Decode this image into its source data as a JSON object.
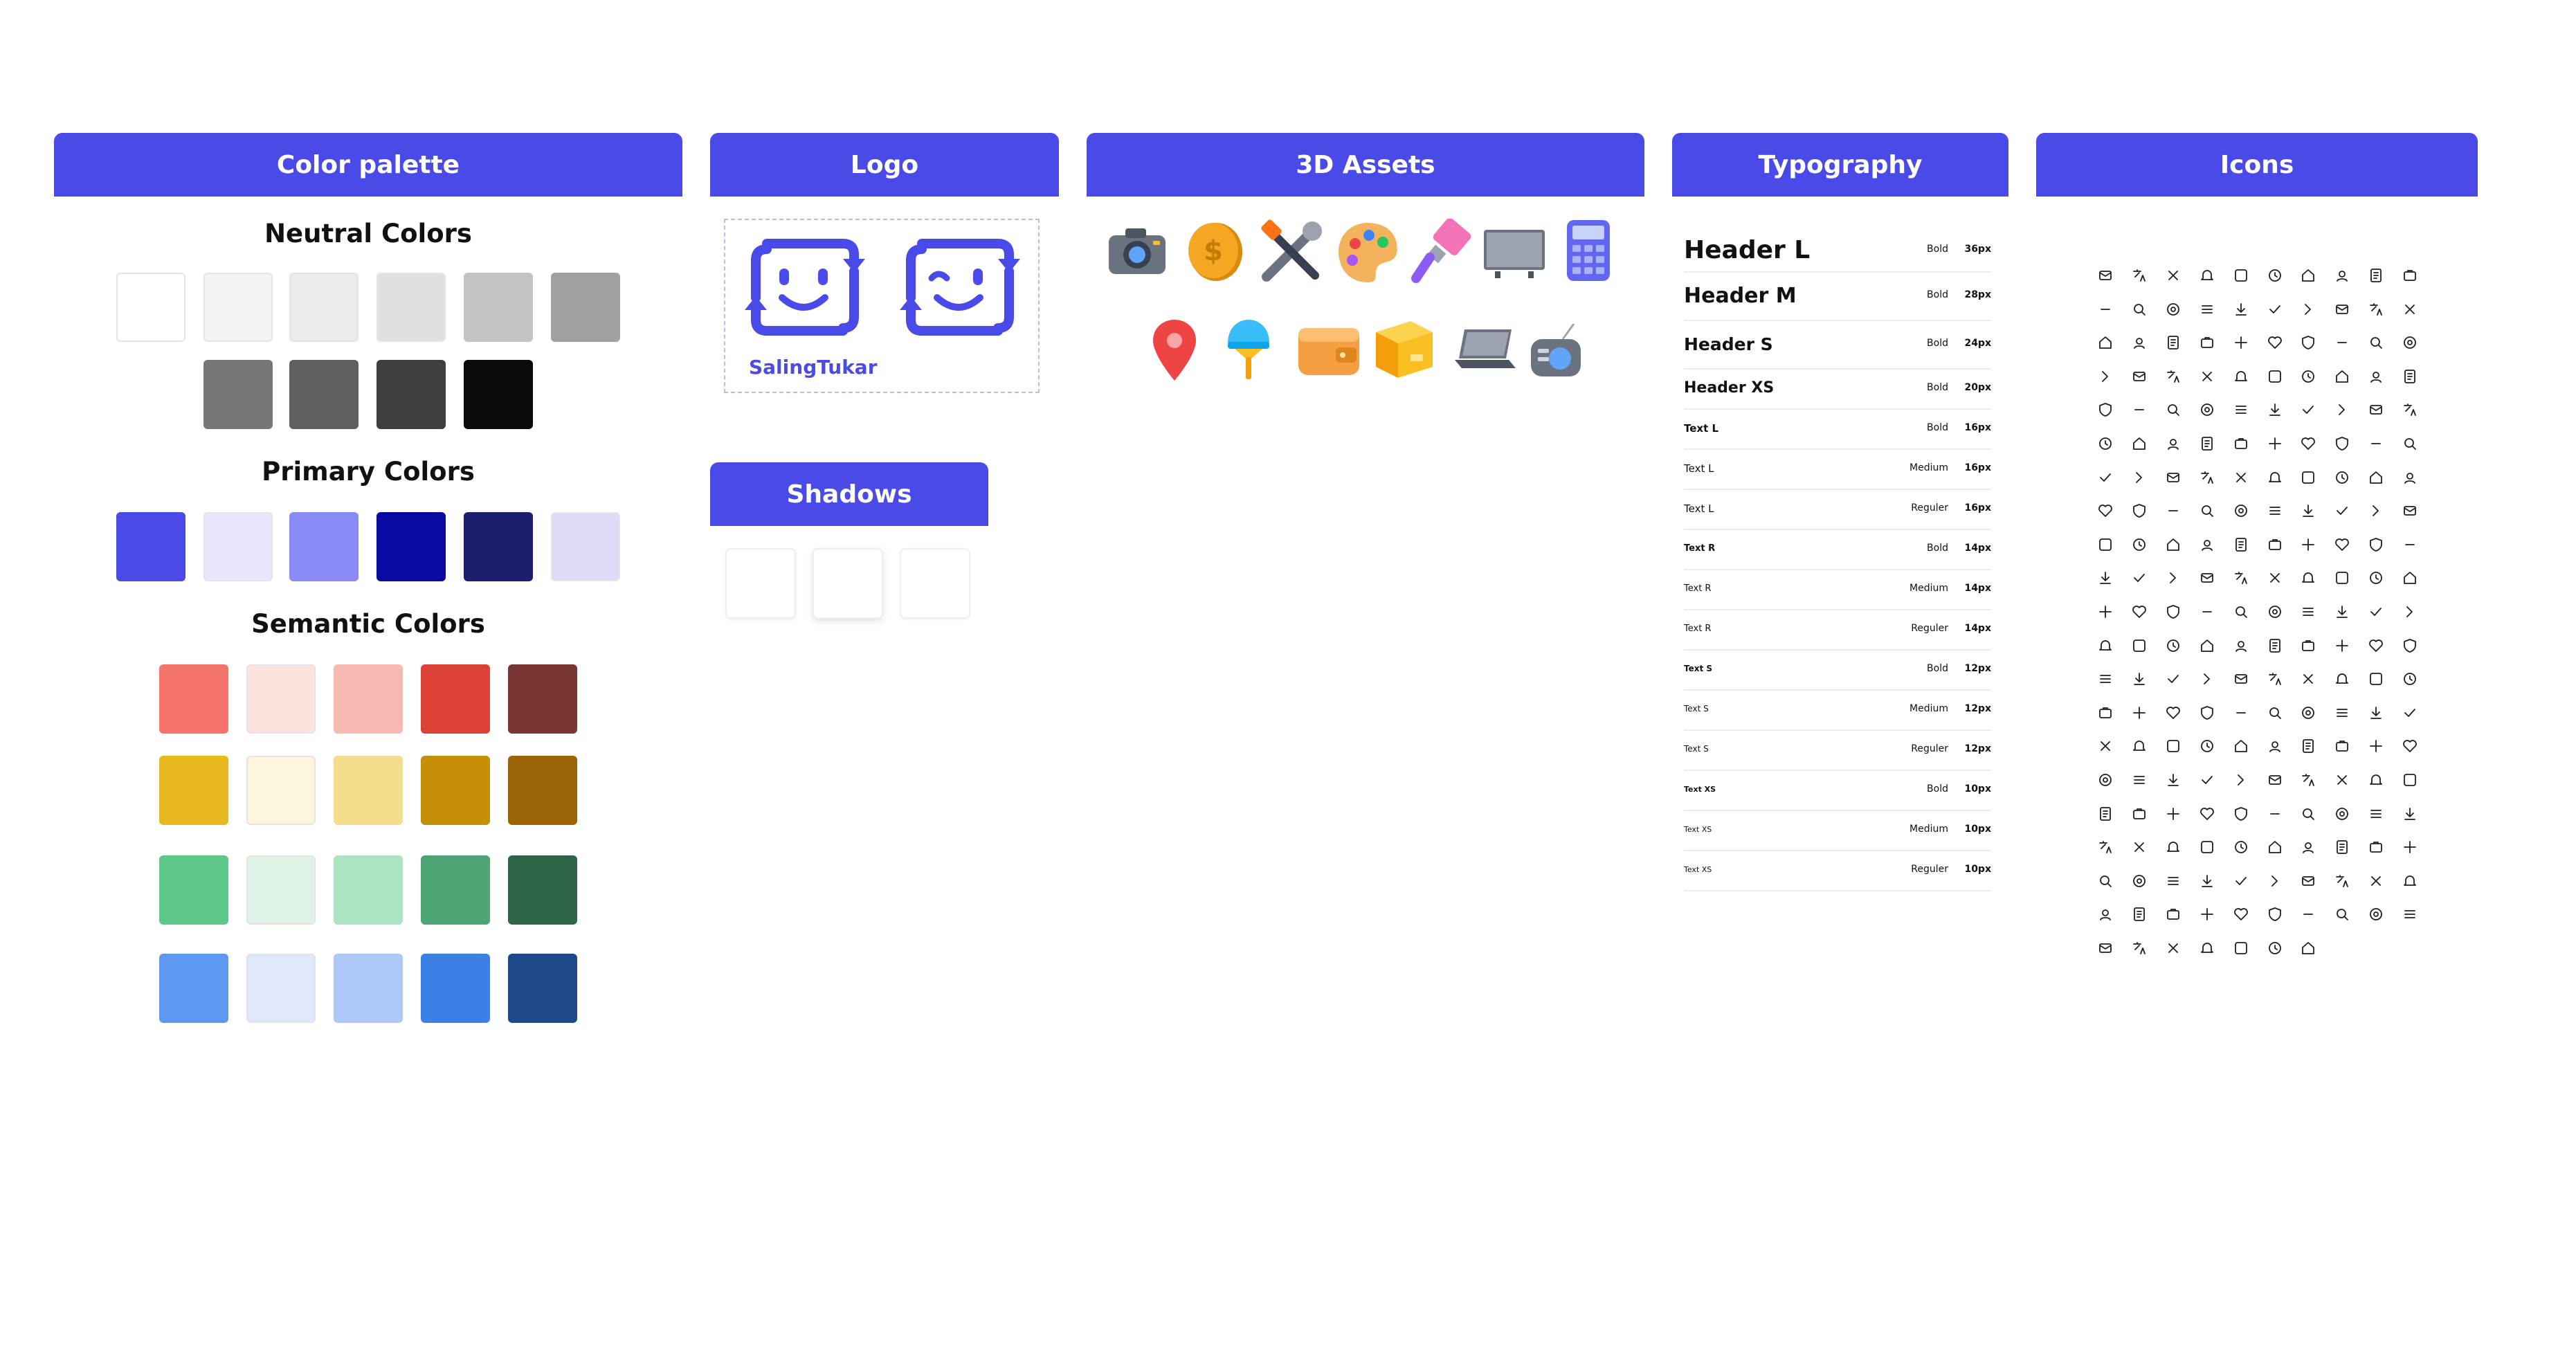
{
  "panels": {
    "color_palette": "Color palette",
    "logo": "Logo",
    "assets": "3D Assets",
    "typography": "Typography",
    "icons": "Icons",
    "shadows": "Shadows"
  },
  "color_palette": {
    "neutral_title": "Neutral Colors",
    "primary_title": "Primary Colors",
    "semantic_title": "Semantic Colors",
    "neutral": [
      "#ffffff",
      "#f4f4f4",
      "#ececec",
      "#e0e0e0",
      "#c3c3c3",
      "#a0a0a0",
      "#777777",
      "#5f5f5f",
      "#3f3f3f",
      "#0a0a0a"
    ],
    "primary": [
      "#4a4ae8",
      "#e7e7fc",
      "#8a8af5",
      "#0a0aa0",
      "#1e1e6e",
      "#dcdcf8"
    ],
    "semantic": [
      [
        "#f5756a",
        "#fde3de",
        "#f7b9b2",
        "#dc4137",
        "#7a3535"
      ],
      [
        "#e8b91c",
        "#fdf5dc",
        "#f4dd8c",
        "#c68f08",
        "#9a6405"
      ],
      [
        "#5ec88a",
        "#dff3e7",
        "#ace3c1",
        "#4ca573",
        "#2e6548"
      ],
      [
        "#5e99f0",
        "#dfe9fb",
        "#adc9f7",
        "#3b80e4",
        "#1e4a8c"
      ]
    ]
  },
  "logo": {
    "wordmark": "SalingTukar",
    "accent": "#4a4ae8"
  },
  "assets": {
    "items": [
      "camera",
      "coin",
      "tools",
      "palette",
      "paintbrush",
      "tv",
      "calculator",
      "map-pin",
      "ice-cream",
      "wallet",
      "box",
      "laptop",
      "radio"
    ]
  },
  "typography": {
    "rows": [
      {
        "name": "Header L",
        "weight": "Bold",
        "size": "36px"
      },
      {
        "name": "Header M",
        "weight": "Bold",
        "size": "28px"
      },
      {
        "name": "Header S",
        "weight": "Bold",
        "size": "24px"
      },
      {
        "name": "Header XS",
        "weight": "Bold",
        "size": "20px"
      },
      {
        "name": "Text L",
        "weight": "Bold",
        "size": "16px"
      },
      {
        "name": "Text L",
        "weight": "Medium",
        "size": "16px"
      },
      {
        "name": "Text L",
        "weight": "Reguler",
        "size": "16px"
      },
      {
        "name": "Text R",
        "weight": "Bold",
        "size": "14px"
      },
      {
        "name": "Text R",
        "weight": "Medium",
        "size": "14px"
      },
      {
        "name": "Text R",
        "weight": "Reguler",
        "size": "14px"
      },
      {
        "name": "Text S",
        "weight": "Bold",
        "size": "12px"
      },
      {
        "name": "Text S",
        "weight": "Medium",
        "size": "12px"
      },
      {
        "name": "Text S",
        "weight": "Reguler",
        "size": "12px"
      },
      {
        "name": "Text XS",
        "weight": "Bold",
        "size": "10px"
      },
      {
        "name": "Text XS",
        "weight": "Medium",
        "size": "10px"
      },
      {
        "name": "Text XS",
        "weight": "Reguler",
        "size": "10px"
      }
    ]
  },
  "icons": {
    "count": 207,
    "columns": 10
  }
}
